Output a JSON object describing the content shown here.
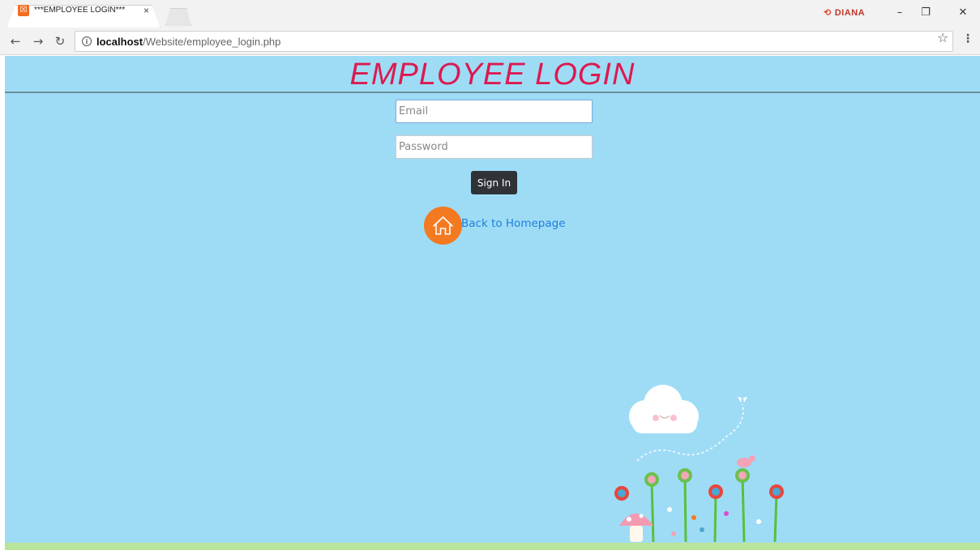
{
  "browser": {
    "tab_title": "***EMPLOYEE LOGIN***",
    "tab_close": "×",
    "profile_name": "DIANA",
    "url_host": "localhost",
    "url_path": "/Website/employee_login.php",
    "icons": [
      "back-arrow-icon",
      "forward-arrow-icon",
      "reload-icon",
      "info-icon",
      "star-icon",
      "menu-icon",
      "minimize-icon",
      "restore-icon",
      "close-icon"
    ]
  },
  "page": {
    "title": "EMPLOYEE LOGIN",
    "email_placeholder": "Email",
    "password_placeholder": "Password",
    "signin_label": "Sign In",
    "back_link": "Back to Homepage"
  },
  "colors": {
    "background": "#9edcf6",
    "title": "#dc1a50",
    "button": "#2f3338",
    "home_circle": "#f47a21",
    "link": "#1f7fdc"
  }
}
